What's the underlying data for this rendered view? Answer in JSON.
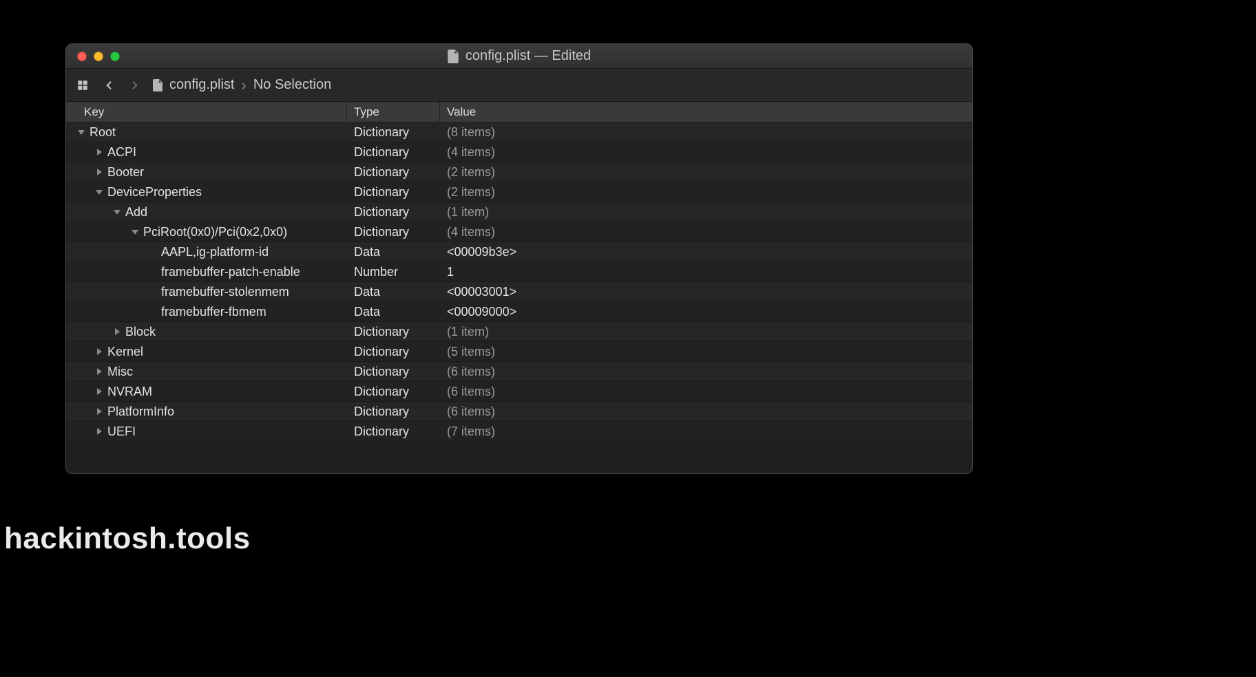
{
  "window": {
    "title": "config.plist — Edited"
  },
  "toolbar": {
    "file": "config.plist",
    "selection": "No Selection"
  },
  "columns": {
    "key": "Key",
    "type": "Type",
    "value": "Value"
  },
  "rows": [
    {
      "indent": 0,
      "disclosure": "down",
      "key": "Root",
      "type": "Dictionary",
      "value": "(8 items)",
      "valueTone": "muted"
    },
    {
      "indent": 1,
      "disclosure": "right",
      "key": "ACPI",
      "type": "Dictionary",
      "value": "(4 items)",
      "valueTone": "muted"
    },
    {
      "indent": 1,
      "disclosure": "right",
      "key": "Booter",
      "type": "Dictionary",
      "value": "(2 items)",
      "valueTone": "muted"
    },
    {
      "indent": 1,
      "disclosure": "down",
      "key": "DeviceProperties",
      "type": "Dictionary",
      "value": "(2 items)",
      "valueTone": "muted"
    },
    {
      "indent": 2,
      "disclosure": "down",
      "key": "Add",
      "type": "Dictionary",
      "value": "(1 item)",
      "valueTone": "muted"
    },
    {
      "indent": 3,
      "disclosure": "down",
      "key": "PciRoot(0x0)/Pci(0x2,0x0)",
      "type": "Dictionary",
      "value": "(4 items)",
      "valueTone": "muted"
    },
    {
      "indent": 4,
      "disclosure": "none",
      "key": "AAPL,ig-platform-id",
      "type": "Data",
      "value": "<00009b3e>",
      "valueTone": "strong"
    },
    {
      "indent": 4,
      "disclosure": "none",
      "key": "framebuffer-patch-enable",
      "type": "Number",
      "value": "1",
      "valueTone": "strong"
    },
    {
      "indent": 4,
      "disclosure": "none",
      "key": "framebuffer-stolenmem",
      "type": "Data",
      "value": "<00003001>",
      "valueTone": "strong"
    },
    {
      "indent": 4,
      "disclosure": "none",
      "key": "framebuffer-fbmem",
      "type": "Data",
      "value": "<00009000>",
      "valueTone": "strong"
    },
    {
      "indent": 2,
      "disclosure": "right",
      "key": "Block",
      "type": "Dictionary",
      "value": "(1 item)",
      "valueTone": "muted"
    },
    {
      "indent": 1,
      "disclosure": "right",
      "key": "Kernel",
      "type": "Dictionary",
      "value": "(5 items)",
      "valueTone": "muted"
    },
    {
      "indent": 1,
      "disclosure": "right",
      "key": "Misc",
      "type": "Dictionary",
      "value": "(6 items)",
      "valueTone": "muted"
    },
    {
      "indent": 1,
      "disclosure": "right",
      "key": "NVRAM",
      "type": "Dictionary",
      "value": "(6 items)",
      "valueTone": "muted"
    },
    {
      "indent": 1,
      "disclosure": "right",
      "key": "PlatformInfo",
      "type": "Dictionary",
      "value": "(6 items)",
      "valueTone": "muted"
    },
    {
      "indent": 1,
      "disclosure": "right",
      "key": "UEFI",
      "type": "Dictionary",
      "value": "(7 items)",
      "valueTone": "muted"
    }
  ],
  "watermark": "hackintosh.tools"
}
